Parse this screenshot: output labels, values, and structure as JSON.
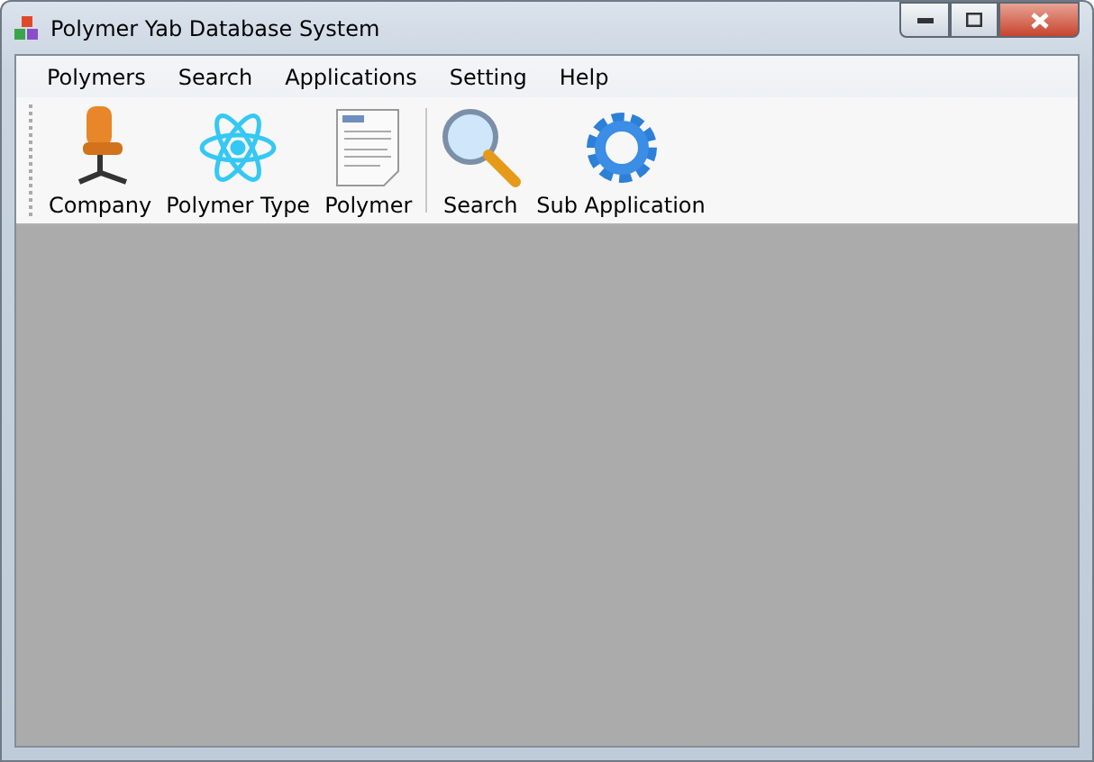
{
  "window": {
    "title": "Polymer Yab Database System"
  },
  "menu": [
    "Polymers",
    "Search",
    "Applications",
    "Setting",
    "Help"
  ],
  "toolbar": [
    {
      "kind": "chair",
      "label": "Company"
    },
    {
      "kind": "atom",
      "label": "Polymer Type"
    },
    {
      "kind": "document",
      "label": "Polymer"
    },
    {
      "kind": "separator"
    },
    {
      "kind": "magnifier",
      "label": "Search"
    },
    {
      "kind": "gear",
      "label": "Sub Application"
    }
  ]
}
